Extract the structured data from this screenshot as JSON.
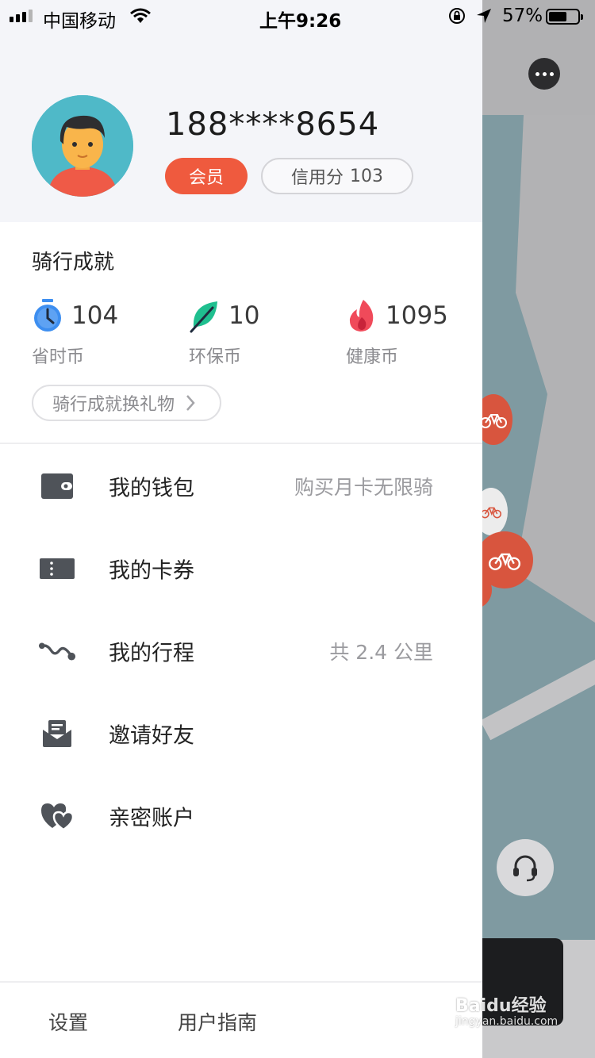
{
  "status_bar": {
    "carrier": "中国移动",
    "time": "上午9:26",
    "battery": "57%"
  },
  "profile": {
    "phone": "188****8654",
    "member_badge": "会员",
    "credit_label": "信用分",
    "credit_value": "103"
  },
  "achievements": {
    "title": "骑行成就",
    "stats": [
      {
        "value": "104",
        "label": "省时币",
        "icon": "stopwatch-icon",
        "color": "#3d8ef0"
      },
      {
        "value": "10",
        "label": "环保币",
        "icon": "leaf-icon",
        "color": "#1fbf8f"
      },
      {
        "value": "1095",
        "label": "健康币",
        "icon": "flame-icon",
        "color": "#f04a5a"
      }
    ],
    "redeem_label": "骑行成就换礼物"
  },
  "menu": [
    {
      "label": "我的钱包",
      "extra": "购买月卡无限骑",
      "icon": "wallet-icon"
    },
    {
      "label": "我的卡券",
      "extra": "",
      "icon": "ticket-icon"
    },
    {
      "label": "我的行程",
      "extra": "共 2.4 公里",
      "icon": "route-icon"
    },
    {
      "label": "邀请好友",
      "extra": "",
      "icon": "invite-mail-icon"
    },
    {
      "label": "亲密账户",
      "extra": "",
      "icon": "hearts-icon"
    }
  ],
  "footer": {
    "settings": "设置",
    "guide": "用户指南"
  },
  "watermark": {
    "brand": "Baidu经验",
    "url": "jingyan.baidu.com"
  },
  "colors": {
    "accent": "#ef5a3e",
    "header_bg": "#f4f5f9"
  }
}
